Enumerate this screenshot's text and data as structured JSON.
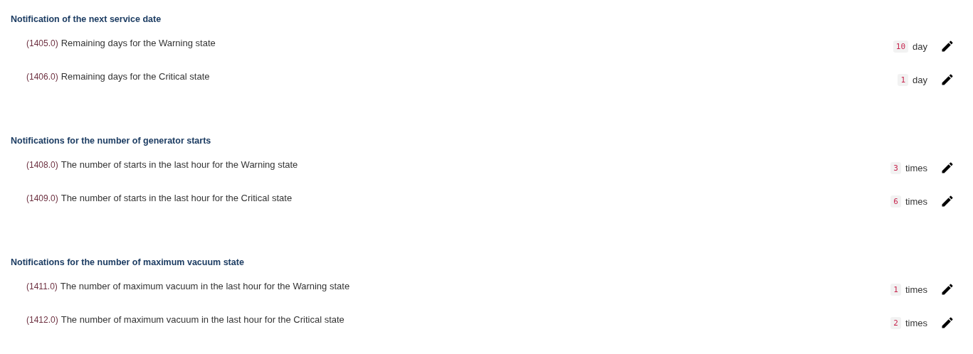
{
  "sections": [
    {
      "title": "Notification of the next service date",
      "rows": [
        {
          "code": "(1405.0)",
          "label": "Remaining days for the Warning state",
          "value": "10",
          "unit": "day"
        },
        {
          "code": "(1406.0)",
          "label": "Remaining days for the Critical state",
          "value": "1",
          "unit": "day"
        }
      ]
    },
    {
      "title": "Notifications for the number of generator starts",
      "rows": [
        {
          "code": "(1408.0)",
          "label": "The number of starts in the last hour for the Warning state",
          "value": "3",
          "unit": "times"
        },
        {
          "code": "(1409.0)",
          "label": "The number of starts in the last hour for the Critical state",
          "value": "6",
          "unit": "times"
        }
      ]
    },
    {
      "title": "Notifications for the number of maximum vacuum state",
      "rows": [
        {
          "code": "(1411.0)",
          "label": "The number of maximum vacuum in the last hour for the Warning state",
          "value": "1",
          "unit": "times"
        },
        {
          "code": "(1412.0)",
          "label": "The number of maximum vacuum in the last hour for the Critical state",
          "value": "2",
          "unit": "times"
        }
      ]
    }
  ]
}
